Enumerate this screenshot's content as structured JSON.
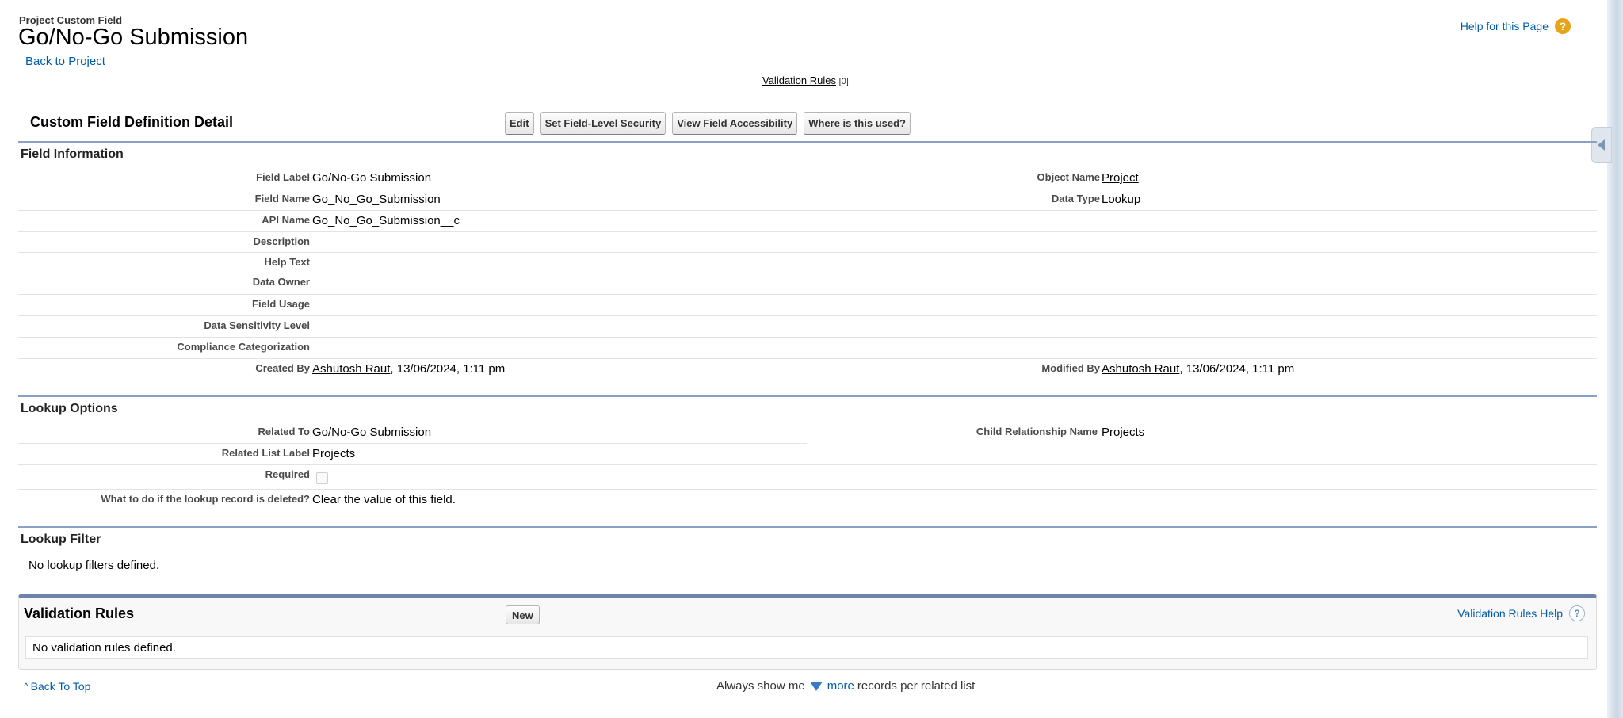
{
  "header": {
    "object_type": "Project Custom Field",
    "title": "Go/No-Go Submission",
    "back_link": "Back to Project",
    "help_link": "Help for this Page",
    "help_icon": "?",
    "validation_rules_link": "Validation Rules",
    "validation_rules_count": "[0]"
  },
  "detail": {
    "title": "Custom Field Definition Detail",
    "buttons": {
      "edit": "Edit",
      "fls": "Set Field-Level Security",
      "accessibility": "View Field Accessibility",
      "where_used": "Where is this used?"
    }
  },
  "field_information": {
    "heading": "Field Information",
    "rows": [
      {
        "label": "Field Label",
        "value": "Go/No-Go Submission",
        "label2": "Object Name",
        "value2": "Project"
      },
      {
        "label": "Field Name",
        "value": "Go_No_Go_Submission",
        "label2": "Data Type",
        "value2": "Lookup"
      },
      {
        "label": "API Name",
        "value": "Go_No_Go_Submission__c"
      },
      {
        "label": "Description",
        "value": ""
      },
      {
        "label": "Help Text",
        "value": ""
      },
      {
        "label": "Data Owner",
        "value": ""
      },
      {
        "label": "Field Usage",
        "value": ""
      },
      {
        "label": "Data Sensitivity Level",
        "value": ""
      },
      {
        "label": "Compliance Categorization",
        "value": ""
      }
    ],
    "created": {
      "label": "Created By",
      "user": "Ashutosh Raut",
      "date": ", 13/06/2024, 1:11 pm"
    },
    "modified": {
      "label": "Modified By",
      "user": "Ashutosh Raut",
      "date": ", 13/06/2024, 1:11 pm"
    }
  },
  "lookup_options": {
    "heading": "Lookup Options",
    "related_to_label": "Related To",
    "related_to_value": "Go/No-Go Submission",
    "child_rel_label": "Child Relationship Name",
    "child_rel_value": "Projects",
    "related_list_label": "Related List Label",
    "related_list_value": "Projects",
    "required_label": "Required",
    "required_checked": false,
    "delete_label": "What to do if the lookup record is deleted?",
    "delete_value": "Clear the value of this field."
  },
  "lookup_filter": {
    "heading": "Lookup Filter",
    "empty": "No lookup filters defined."
  },
  "validation_rules": {
    "title": "Validation Rules",
    "new_button": "New",
    "help_link": "Validation Rules Help",
    "help_icon": "?",
    "empty": "No validation rules defined."
  },
  "footer": {
    "back_to_top": "Back To Top",
    "always_show_prefix": "Always show me",
    "more": "more",
    "suffix": "records per related list"
  }
}
